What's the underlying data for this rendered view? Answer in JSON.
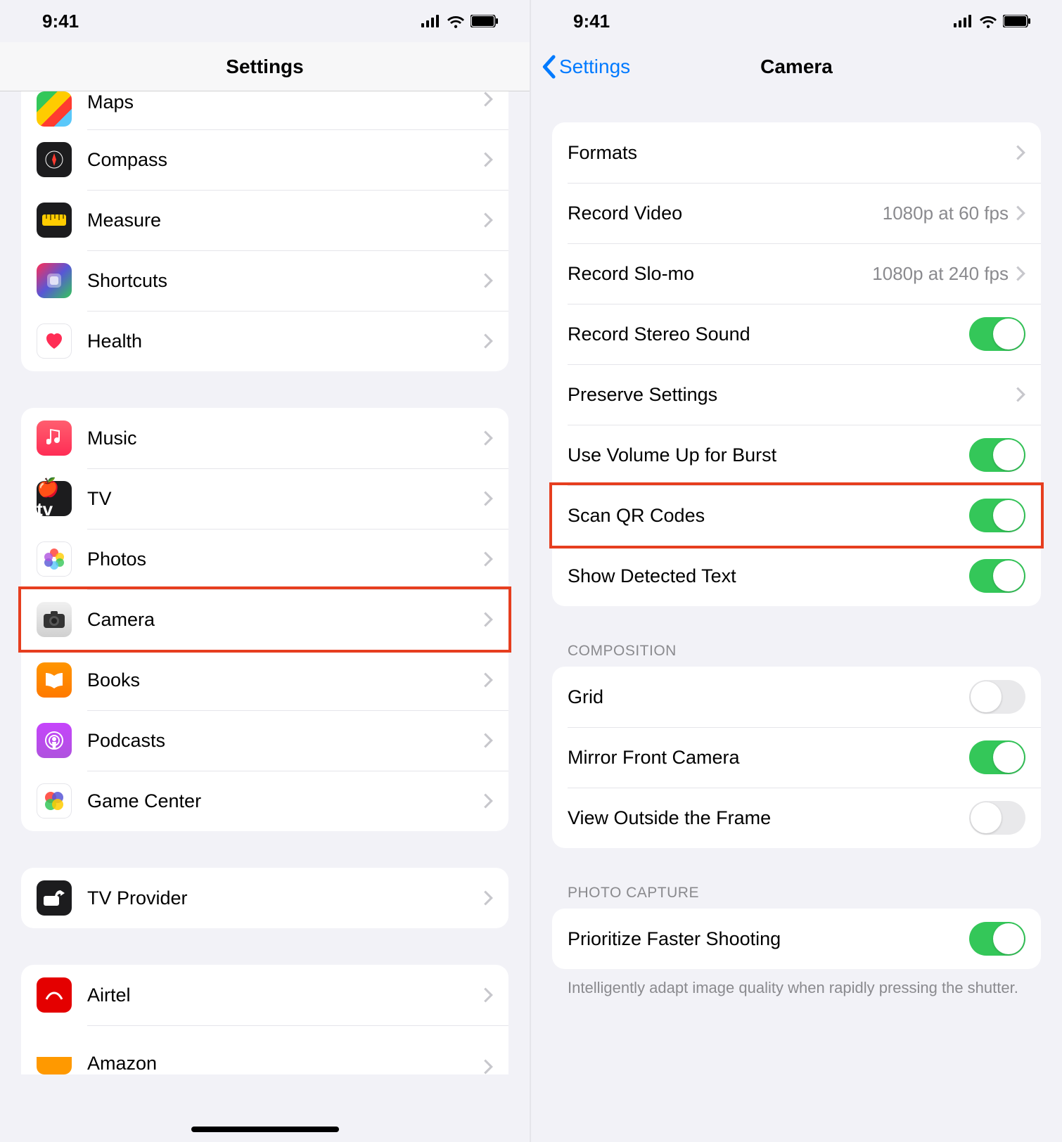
{
  "status": {
    "time": "9:41"
  },
  "left": {
    "title": "Settings",
    "group1": [
      {
        "name": "maps",
        "label": "Maps"
      },
      {
        "name": "compass",
        "label": "Compass"
      },
      {
        "name": "measure",
        "label": "Measure"
      },
      {
        "name": "shortcuts",
        "label": "Shortcuts"
      },
      {
        "name": "health",
        "label": "Health"
      }
    ],
    "group2": [
      {
        "name": "music",
        "label": "Music"
      },
      {
        "name": "tv",
        "label": "TV"
      },
      {
        "name": "photos",
        "label": "Photos"
      },
      {
        "name": "camera",
        "label": "Camera"
      },
      {
        "name": "books",
        "label": "Books"
      },
      {
        "name": "podcasts",
        "label": "Podcasts"
      },
      {
        "name": "gamecenter",
        "label": "Game Center"
      }
    ],
    "group3": [
      {
        "name": "tvprovider",
        "label": "TV Provider"
      }
    ],
    "group4": [
      {
        "name": "airtel",
        "label": "Airtel"
      },
      {
        "name": "amazon",
        "label": "Amazon"
      }
    ]
  },
  "right": {
    "back": "Settings",
    "title": "Camera",
    "section1": {
      "formats": "Formats",
      "recordVideo": {
        "label": "Record Video",
        "detail": "1080p at 60 fps"
      },
      "recordSlomo": {
        "label": "Record Slo-mo",
        "detail": "1080p at 240 fps"
      },
      "stereo": {
        "label": "Record Stereo Sound",
        "on": true
      },
      "preserve": "Preserve Settings",
      "volumeBurst": {
        "label": "Use Volume Up for Burst",
        "on": true
      },
      "scanQR": {
        "label": "Scan QR Codes",
        "on": true
      },
      "detectedText": {
        "label": "Show Detected Text",
        "on": true
      }
    },
    "section2": {
      "header": "COMPOSITION",
      "grid": {
        "label": "Grid",
        "on": false
      },
      "mirror": {
        "label": "Mirror Front Camera",
        "on": true
      },
      "outside": {
        "label": "View Outside the Frame",
        "on": false
      }
    },
    "section3": {
      "header": "PHOTO CAPTURE",
      "prioritize": {
        "label": "Prioritize Faster Shooting",
        "on": true
      },
      "footer": "Intelligently adapt image quality when rapidly pressing the shutter."
    }
  }
}
